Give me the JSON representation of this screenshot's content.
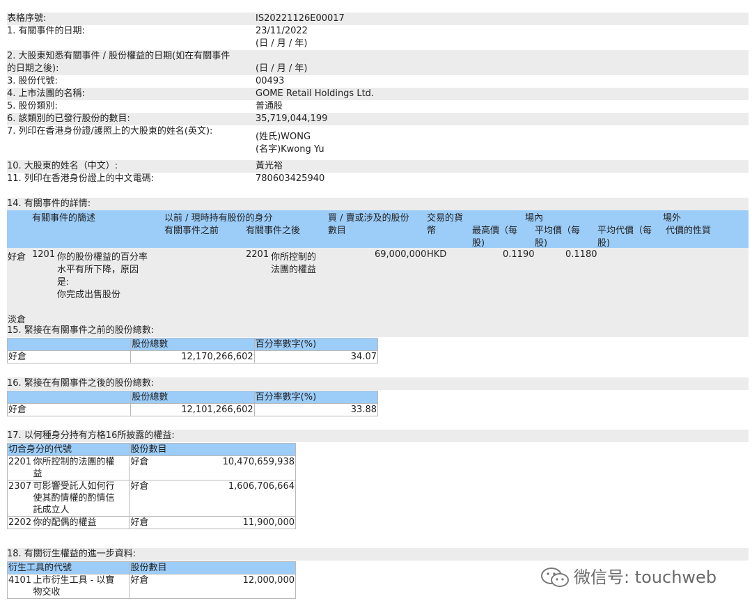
{
  "header": {
    "serial_label": "表格序號:",
    "serial_value": "IS20221126E00017",
    "q1_label": "1. 有關事件的日期:",
    "q1_value": "23/11/2022",
    "q1_format": "(日 / 月 / 年)",
    "q2_label_line1": "2. 大股東知悉有關事件 / 股份權益的日期(如在有關事件",
    "q2_label_line2": "的日期之後):",
    "q2_format": "(日 / 月 / 年)",
    "q3_label": "3. 股份代號:",
    "q3_value": "00493",
    "q4_label": "4. 上市法團的名稱:",
    "q4_value": "GOME Retail Holdings Ltd.",
    "q5_label": "5. 股份類別:",
    "q5_value": "普通股",
    "q6_label": "6. 該類別的已發行股份的數目:",
    "q6_value": "35,719,044,199",
    "q7_label": "7. 列印在香港身份證/護照上的大股東的姓名(英文):",
    "q7_surname": "(姓氏)WONG",
    "q7_given": "(名字)Kwong Yu",
    "q10_label": "10. 大股東的姓名（中文）:",
    "q10_value": "黃光裕",
    "q11_label": "11. 列印在香港身份證上的中文電碼:",
    "q11_value": "780603425940"
  },
  "section14": {
    "title": "14. 有關事件的詳情:",
    "headers": {
      "event_desc": "有關事件的簡述",
      "capacity": "以前 / 現時持有股份的身分",
      "before": "有關事件之前",
      "after": "有關事件之後",
      "shares_line1": "買 / 賣或涉及的股份",
      "shares_line2": "數目",
      "currency_line1": "交易的貨",
      "currency_line2": "幣",
      "onexchange": "場內",
      "high_line1": "最高價（每",
      "high_line2": "股)",
      "avg_line1": "平均價（每",
      "avg_line2": "股)",
      "offexchange": "場外",
      "offavg_line1": "平均代價（每",
      "offavg_line2": "股)",
      "consideration": "代價的性質"
    },
    "row": {
      "position": "好倉",
      "code": "1201",
      "desc_line1": "你的股份權益的百分率",
      "desc_line2": "水平有所下降，原因",
      "desc_line3": "是:",
      "desc_line4": "你完成出售股份",
      "after_code": "2201",
      "after_line1": "你所控制的",
      "after_line2": "法團的權益",
      "shares": "69,000,000",
      "currency": "HKD",
      "high": "0.1190",
      "avg": "0.1180"
    },
    "short_label": "淡倉"
  },
  "section15": {
    "title": "15. 緊接在有關事件之前的股份總數:",
    "col_shares": "股份總數",
    "col_percent": "百分率數字(%)",
    "row_label": "好倉",
    "shares": "12,170,266,602",
    "percent": "34.07"
  },
  "section16": {
    "title": "16. 緊接在有關事件之後的股份總數:",
    "col_shares": "股份總數",
    "col_percent": "百分率數字(%)",
    "row_label": "好倉",
    "shares": "12,101,266,602",
    "percent": "33.88"
  },
  "section17": {
    "title": "17. 以何種身分持有方格16所披露的權益:",
    "col_capacity": "切合身分的代號",
    "col_shares": "股份數目",
    "rows": [
      {
        "code": "2201",
        "lines": [
          "你所控制的法團的權",
          "益"
        ],
        "position": "好倉",
        "shares": "10,470,659,938"
      },
      {
        "code": "2307",
        "lines": [
          "可影響受託人如何行",
          "使其酌情權的酌情信",
          "託成立人"
        ],
        "position": "好倉",
        "shares": "1,606,706,664"
      },
      {
        "code": "2202",
        "lines": [
          "你的配偶的權益"
        ],
        "position": "好倉",
        "shares": "11,900,000"
      }
    ]
  },
  "section18": {
    "title": "18. 有關衍生權益的進一步資料:",
    "col_code": "衍生工具的代號",
    "col_shares": "股份數目",
    "row": {
      "code": "4101",
      "lines": [
        "上市衍生工具 - 以實",
        "物交收"
      ],
      "position": "好倉",
      "shares": "12,000,000"
    }
  },
  "watermark": {
    "text": "微信号: touchweb",
    "icon": "wechat-icon"
  }
}
